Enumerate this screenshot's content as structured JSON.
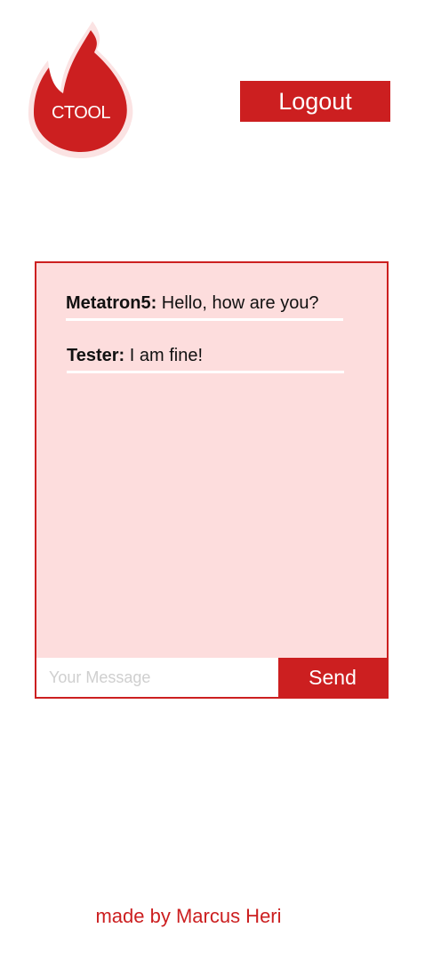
{
  "logo": {
    "text": "CTOOL",
    "icon": "flame-icon",
    "color": "#cc1f20",
    "glow_color": "#fbe3e3"
  },
  "header": {
    "logout_label": "Logout"
  },
  "chat": {
    "messages": [
      {
        "author": "Metatron5:",
        "text": " Hello, how are you?"
      },
      {
        "author": "Tester:",
        "text": " I am fine!"
      }
    ],
    "input_placeholder": "Your Message",
    "input_value": "",
    "send_label": "Send",
    "background_color": "#fddddd"
  },
  "footer": {
    "text": "made by Marcus Heri"
  }
}
